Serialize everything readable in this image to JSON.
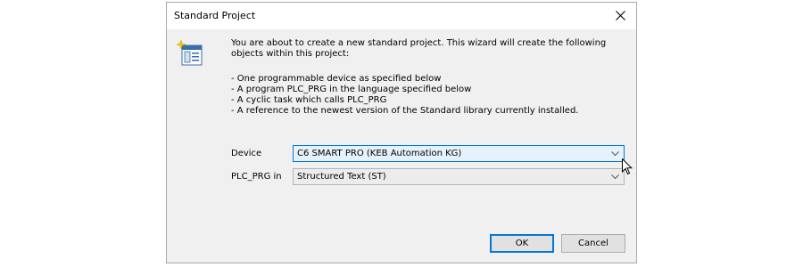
{
  "dialog": {
    "title": "Standard Project",
    "close_icon": "close-icon",
    "wizard_icon": "wizard-icon",
    "intro_line1": "You are about to create a new standard project. This wizard will create the following",
    "intro_line2": "objects within this project:",
    "bullets": [
      "- One programmable device as specified below",
      "- A program PLC_PRG in the language specified below",
      "- A cyclic task which calls PLC_PRG",
      "- A reference to the newest version of the Standard library currently installed."
    ],
    "device_label": "Device",
    "device_value": "C6 SMART PRO (KEB Automation KG)",
    "plcprg_label": "PLC_PRG in",
    "plcprg_value": "Structured Text (ST)",
    "ok_label": "OK",
    "cancel_label": "Cancel"
  },
  "colors": {
    "accent": "#0078d7",
    "dialog_bg": "#f0f0f0",
    "titlebar_bg": "#ffffff"
  }
}
